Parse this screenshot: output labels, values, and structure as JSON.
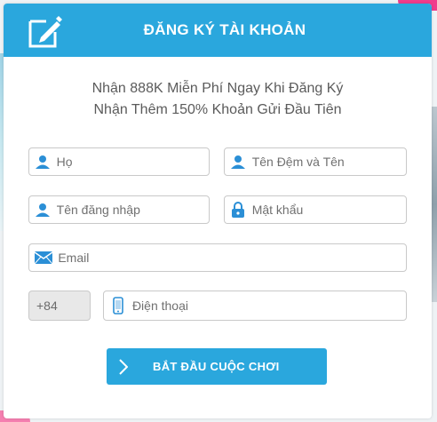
{
  "header": {
    "title": "ĐĂNG KÝ TÀI KHOẢN",
    "icon": "edit-icon",
    "bg_color": "#2aa7dd"
  },
  "promo": {
    "line1": "Nhận 888K Miễn Phí Ngay Khi Đăng Ký",
    "line2": "Nhận Thêm 150% Khoản Gửi Đầu Tiên"
  },
  "form": {
    "last_name": {
      "placeholder": "Họ",
      "icon": "user-icon"
    },
    "full_name": {
      "placeholder": "Tên Đệm và Tên",
      "icon": "user-icon"
    },
    "username": {
      "placeholder": "Tên đăng nhập",
      "icon": "user-icon"
    },
    "password": {
      "placeholder": "Mật khẩu",
      "icon": "lock-icon"
    },
    "email": {
      "placeholder": "Email",
      "icon": "envelope-icon"
    },
    "country_code": "+84",
    "phone": {
      "placeholder": "Điện thoại",
      "icon": "mobile-phone-icon"
    }
  },
  "submit": {
    "label": "BẮT ĐẦU CUỘC CHƠI",
    "icon": "chevron-right-icon"
  },
  "colors": {
    "accent": "#2aa7dd",
    "icon": "#2b8fd6",
    "field_border": "#c9c9c9"
  }
}
